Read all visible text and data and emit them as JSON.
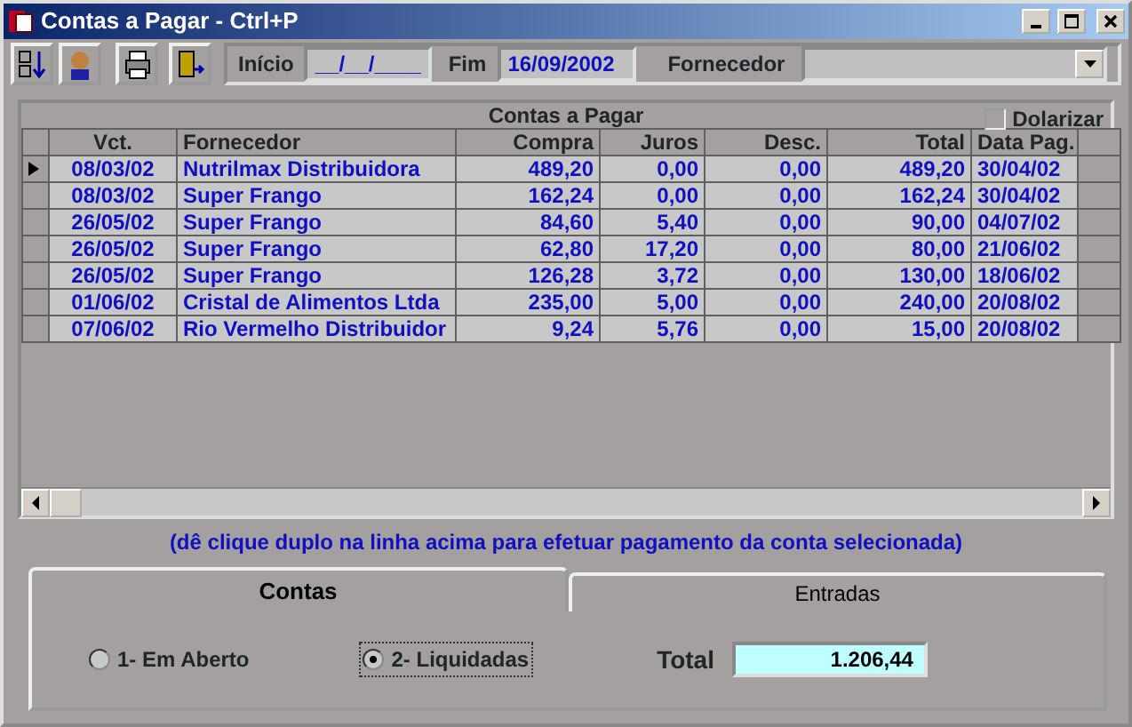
{
  "window": {
    "title": "Contas a Pagar - Ctrl+P"
  },
  "toolbar": {
    "start_label": "Início",
    "start_value": "__/__/____",
    "end_label": "Fim",
    "end_value": "16/09/2002",
    "supplier_label": "Fornecedor"
  },
  "dolarizar": {
    "label": "Dolarizar",
    "checked": false
  },
  "grid": {
    "title": "Contas a Pagar",
    "columns": [
      "Vct.",
      "Fornecedor",
      "Compra",
      "Juros",
      "Desc.",
      "Total",
      "Data Pag."
    ],
    "rows": [
      {
        "selected": true,
        "cells": [
          "08/03/02",
          "Nutrilmax Distribuidora",
          "489,20",
          "0,00",
          "0,00",
          "489,20",
          "30/04/02"
        ]
      },
      {
        "selected": false,
        "cells": [
          "08/03/02",
          "Super Frango",
          "162,24",
          "0,00",
          "0,00",
          "162,24",
          "30/04/02"
        ]
      },
      {
        "selected": false,
        "cells": [
          "26/05/02",
          "Super Frango",
          "84,60",
          "5,40",
          "0,00",
          "90,00",
          "04/07/02"
        ]
      },
      {
        "selected": false,
        "cells": [
          "26/05/02",
          "Super Frango",
          "62,80",
          "17,20",
          "0,00",
          "80,00",
          "21/06/02"
        ]
      },
      {
        "selected": false,
        "cells": [
          "26/05/02",
          "Super Frango",
          "126,28",
          "3,72",
          "0,00",
          "130,00",
          "18/06/02"
        ]
      },
      {
        "selected": false,
        "cells": [
          "01/06/02",
          "Cristal de Alimentos Ltda",
          "235,00",
          "5,00",
          "0,00",
          "240,00",
          "20/08/02"
        ]
      },
      {
        "selected": false,
        "cells": [
          "07/06/02",
          "Rio Vermelho Distribuidor",
          "9,24",
          "5,76",
          "0,00",
          "15,00",
          "20/08/02"
        ]
      }
    ]
  },
  "hint": "(dê clique duplo na linha acima para efetuar pagamento da conta selecionada)",
  "tabs": [
    {
      "label": "Contas",
      "selected": true
    },
    {
      "label": "Entradas",
      "selected": false
    }
  ],
  "options": [
    {
      "label": "1- Em Aberto",
      "selected": false
    },
    {
      "label": "2- Liquidadas",
      "selected": true
    }
  ],
  "total": {
    "label": "Total",
    "value": "1.206,44"
  }
}
